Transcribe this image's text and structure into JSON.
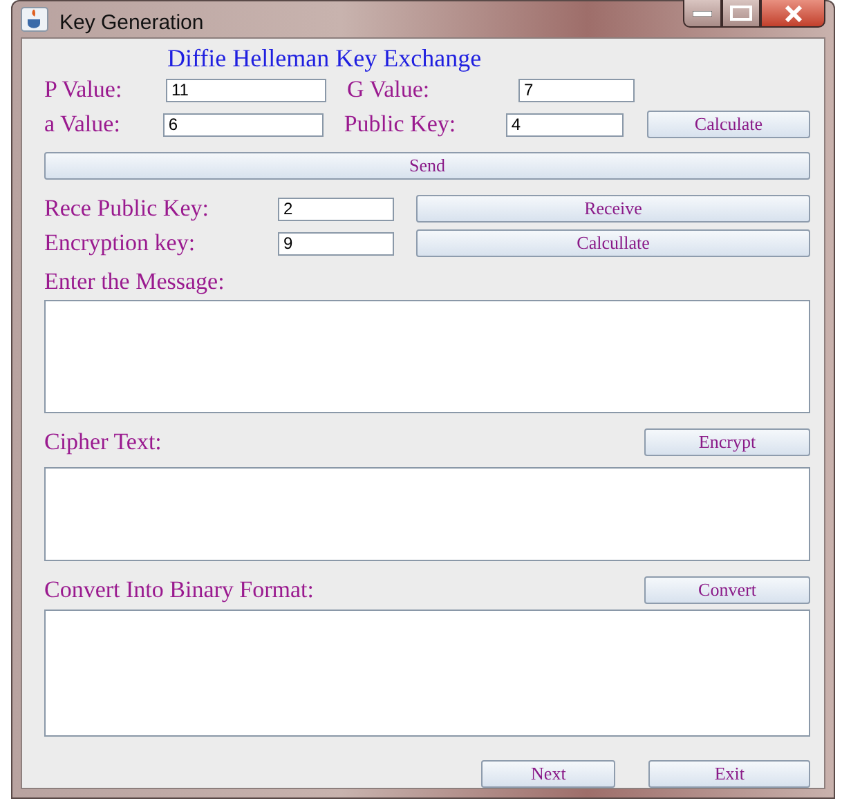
{
  "window": {
    "title": "Key Generation"
  },
  "heading": "Diffie Helleman Key Exchange",
  "p_value": {
    "label": "P Value:",
    "value": "11"
  },
  "g_value": {
    "label": "G Value:",
    "value": "7"
  },
  "a_value": {
    "label": "a Value:",
    "value": "6"
  },
  "public_key": {
    "label": "Public Key:",
    "value": "4"
  },
  "calculate_button": "Calculate",
  "send_button": "Send",
  "received_key": {
    "label": "Rece Public Key:",
    "value": "2"
  },
  "receive_button": "Receive",
  "encryption_key": {
    "label": "Encryption key:",
    "value": "9"
  },
  "calculate_key_button": "Calcullate",
  "message": {
    "label": "Enter the Message:"
  },
  "cipher": {
    "label": "Cipher Text:",
    "button": "Encrypt"
  },
  "binary": {
    "label": "Convert Into Binary Format:",
    "button": "Convert"
  },
  "footer_buttons": [
    "Next",
    "Exit"
  ]
}
